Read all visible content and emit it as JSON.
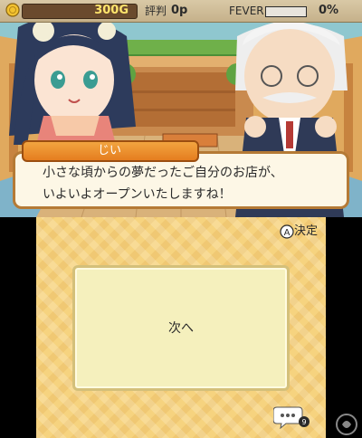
{
  "hud": {
    "money": "300G",
    "reputation_label": "評判",
    "reputation_value": "0p",
    "fever_label": "FEVER",
    "fever_value": "0%",
    "fever_fraction": 0
  },
  "dialog": {
    "speaker": "じい",
    "line1": "小さな頃からの夢だったご自分のお店が、",
    "line2": "いよいよオープンいたしますね！"
  },
  "bottom": {
    "confirm_label": "決定",
    "next_label": "次へ"
  },
  "icons": [
    "coin-icon",
    "a-button-icon",
    "chat-icon",
    "watermark-logo-icon"
  ],
  "colors": {
    "name_box": "#e57d1f",
    "dialog_border": "#b57a35",
    "bottom_background": "#f6d37f",
    "panel": "#f5f0bd",
    "money_text": "#ffe56c",
    "fever_fill": "#f05a28"
  }
}
